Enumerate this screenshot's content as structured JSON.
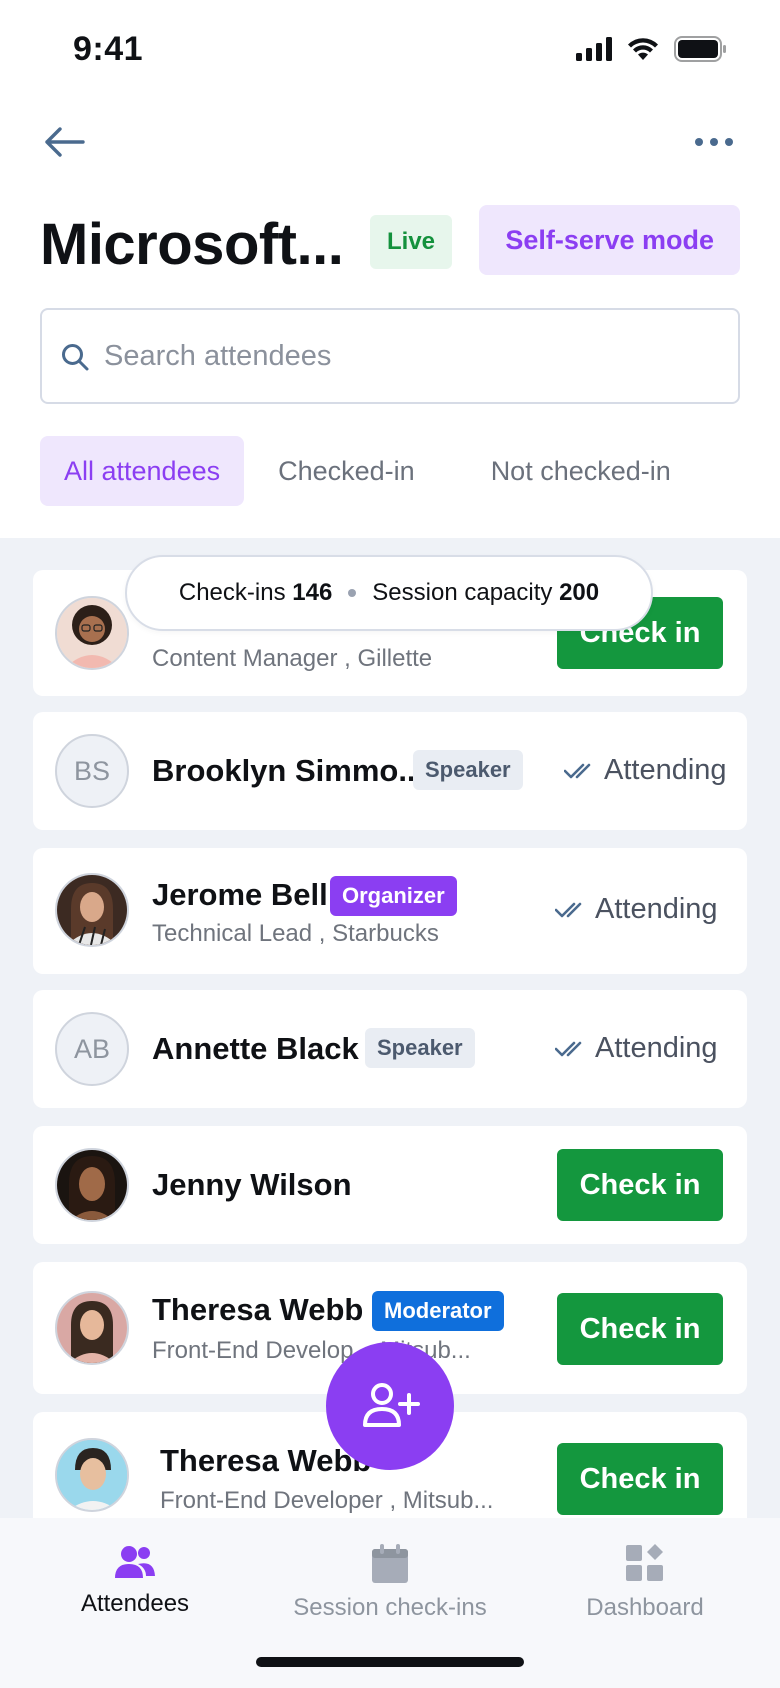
{
  "status_bar": {
    "time": "9:41"
  },
  "header": {
    "title": "Microsoft...",
    "status_badge": "Live",
    "mode_button": "Self-serve mode"
  },
  "search": {
    "placeholder": "Search attendees",
    "value": ""
  },
  "tabs": [
    {
      "label": "All attendees",
      "active": true
    },
    {
      "label": "Checked-in",
      "active": false
    },
    {
      "label": "Not checked-in",
      "active": false
    }
  ],
  "capacity": {
    "checkins_label": "Check-ins",
    "checkins_value": "146",
    "capacity_label": "Session capacity",
    "capacity_value": "200"
  },
  "attendees": [
    {
      "name": "",
      "subtitle": "Content Manager , Gillette",
      "avatar": "photo",
      "action": "Check in"
    },
    {
      "name": "Brooklyn Simmo..",
      "initials": "BS",
      "role": "Speaker",
      "status": "Attending"
    },
    {
      "name": "Jerome Bell",
      "subtitle": "Technical Lead , Starbucks",
      "avatar": "photo",
      "role": "Organizer",
      "status": "Attending"
    },
    {
      "name": "Annette Black",
      "initials": "AB",
      "role": "Speaker",
      "status": "Attending"
    },
    {
      "name": "Jenny Wilson",
      "avatar": "photo",
      "action": "Check in"
    },
    {
      "name": "Theresa Webb",
      "subtitle": "Front-End Develop... Mitsub...",
      "avatar": "photo",
      "role": "Moderator",
      "action": "Check in"
    },
    {
      "name": "Theresa Webb",
      "subtitle": "Front-End Developer , Mitsub...",
      "avatar": "photo",
      "action": "Check in"
    }
  ],
  "bottom_nav": [
    {
      "label": "Attendees",
      "icon": "users-icon",
      "active": true
    },
    {
      "label": "Session check-ins",
      "icon": "calendar-icon",
      "active": false
    },
    {
      "label": "Dashboard",
      "icon": "dashboard-icon",
      "active": false
    }
  ],
  "colors": {
    "accent": "#8b3ef2",
    "checkin_green": "#14973e",
    "live_green": "#14913d",
    "moderator_blue": "#0f6fdc"
  }
}
